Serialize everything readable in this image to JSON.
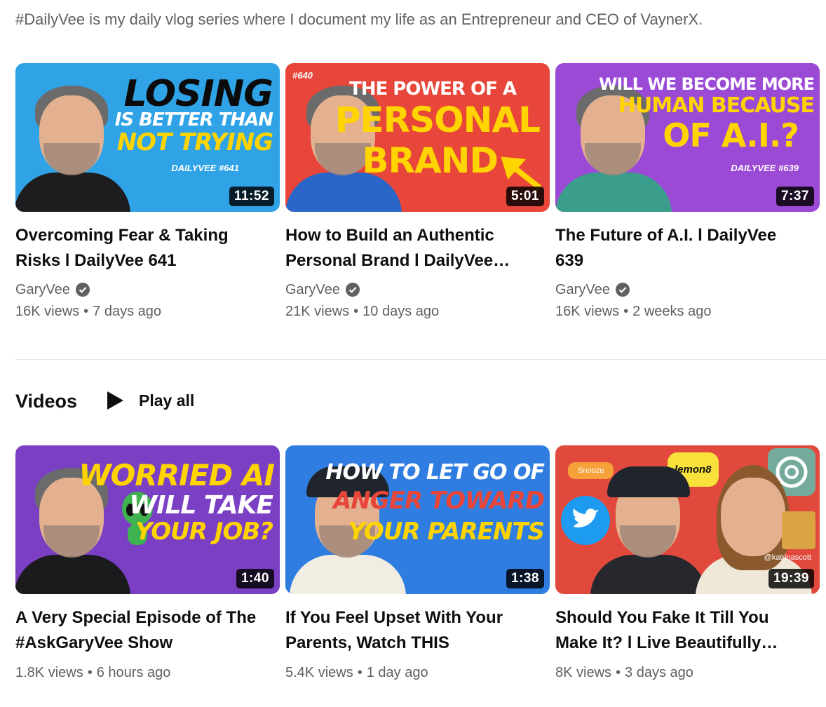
{
  "playlist_description": "#DailyVee is my daily vlog series where I document my life as an Entrepreneur and CEO of VaynerX.",
  "playlist_videos": [
    {
      "title": "Overcoming Fear & Taking Risks l DailyVee 641",
      "channel": "GaryVee",
      "views": "16K views",
      "age": "7 days ago",
      "duration": "11:52",
      "thumb_text": [
        "LOSING",
        "IS BETTER THAN",
        "NOT TRYING"
      ],
      "thumb_tag": "DAILYVEE #641",
      "thumb_bg": "#2fa3e6"
    },
    {
      "title": "How to Build an Authentic Personal Brand l DailyVee…",
      "channel": "GaryVee",
      "views": "21K views",
      "age": "10 days ago",
      "duration": "5:01",
      "thumb_text": [
        "THE POWER OF A",
        "PERSONAL",
        "BRAND"
      ],
      "thumb_tag": "#640",
      "thumb_bg": "#e8463a"
    },
    {
      "title": "The Future of A.I. l DailyVee 639",
      "channel": "GaryVee",
      "views": "16K views",
      "age": "2 weeks ago",
      "duration": "7:37",
      "thumb_text": [
        "WILL WE BECOME MORE",
        "HUMAN BECAUSE",
        "OF A.I.?"
      ],
      "thumb_tag": "DAILYVEE #639",
      "thumb_bg": "#9b4ad6"
    }
  ],
  "videos_section": {
    "title": "Videos",
    "play_all_label": "Play all",
    "items": [
      {
        "title": "A Very Special Episode of The #AskGaryVee Show",
        "views": "1.8K views",
        "age": "6 hours ago",
        "duration": "1:40",
        "thumb_text": [
          "WORRIED AI",
          "WILL TAKE",
          "YOUR JOB?"
        ],
        "thumb_bg": "#7b3fc4"
      },
      {
        "title": "If You Feel Upset With Your Parents, Watch THIS",
        "views": "5.4K views",
        "age": "1 day ago",
        "duration": "1:38",
        "thumb_text": [
          "HOW TO LET GO OF",
          "ANGER TOWARD",
          "YOUR PARENTS"
        ],
        "thumb_bg": "#2f7de0"
      },
      {
        "title": "Should You Fake It Till You Make It? l Live Beautifully…",
        "views": "8K views",
        "age": "3 days ago",
        "duration": "19:39",
        "thumb_text": [
          "Snooze",
          "lemon8",
          "@katrinascott"
        ],
        "thumb_bg": "#e0493c"
      }
    ]
  },
  "meta_separator": "•",
  "colors": {
    "text_primary": "#0f0f0f",
    "text_secondary": "#606060",
    "divider": "#e5e5e5",
    "accent_yellow": "#ffd400"
  }
}
